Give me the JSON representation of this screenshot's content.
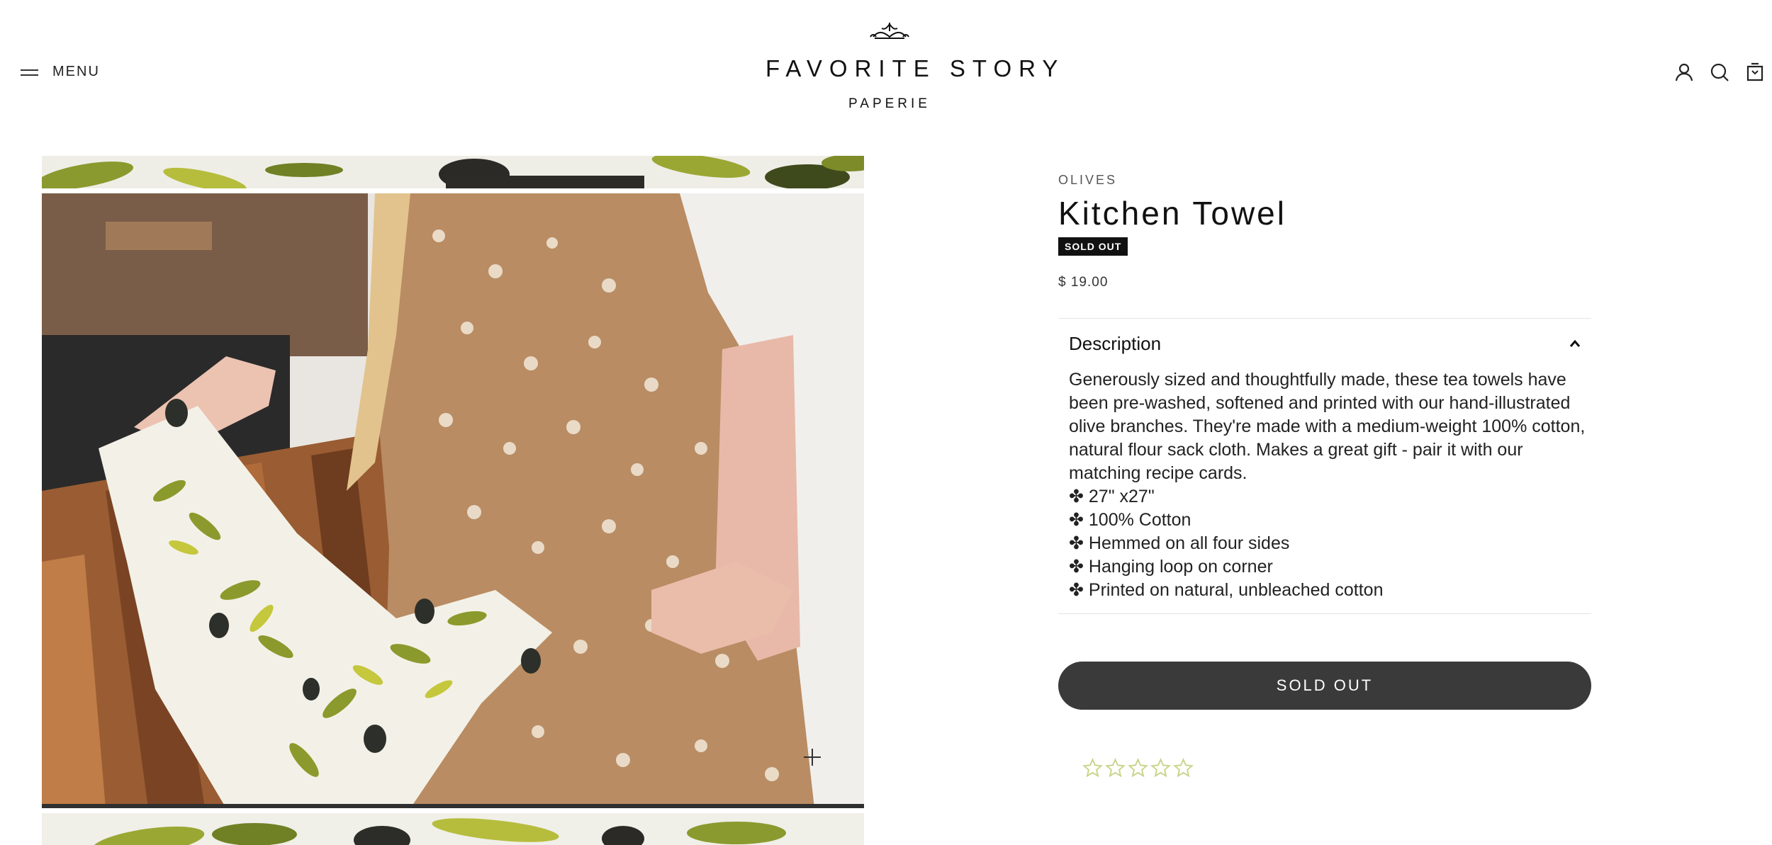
{
  "header": {
    "menu_label": "MENU",
    "logo_title": "FAVORITE STORY",
    "logo_subtitle": "PAPERIE"
  },
  "product": {
    "vendor": "OLIVES",
    "title": "Kitchen Towel",
    "badge": "SOLD OUT",
    "price": "$ 19.00",
    "description_heading": "Description",
    "description_paragraph": "Generously sized and thoughtfully made, these tea towels have been pre-washed, softened and printed with our hand-illustrated olive branches. They're made with a medium-weight 100% cotton, natural flour sack cloth.  Makes a great gift - pair it with our matching recipe cards.",
    "features": [
      "✤ 27\" x27\"",
      "✤ 100% Cotton",
      "✤ Hemmed on all four sides",
      "✤ Hanging loop on corner",
      "✤ Printed on natural, unbleached cotton"
    ],
    "button_label": "SOLD OUT",
    "rating_stars": 0,
    "rating_max": 5
  },
  "colors": {
    "button_bg": "#3a3a3a",
    "badge_bg": "#111111",
    "star_outline": "#c9d48a"
  }
}
